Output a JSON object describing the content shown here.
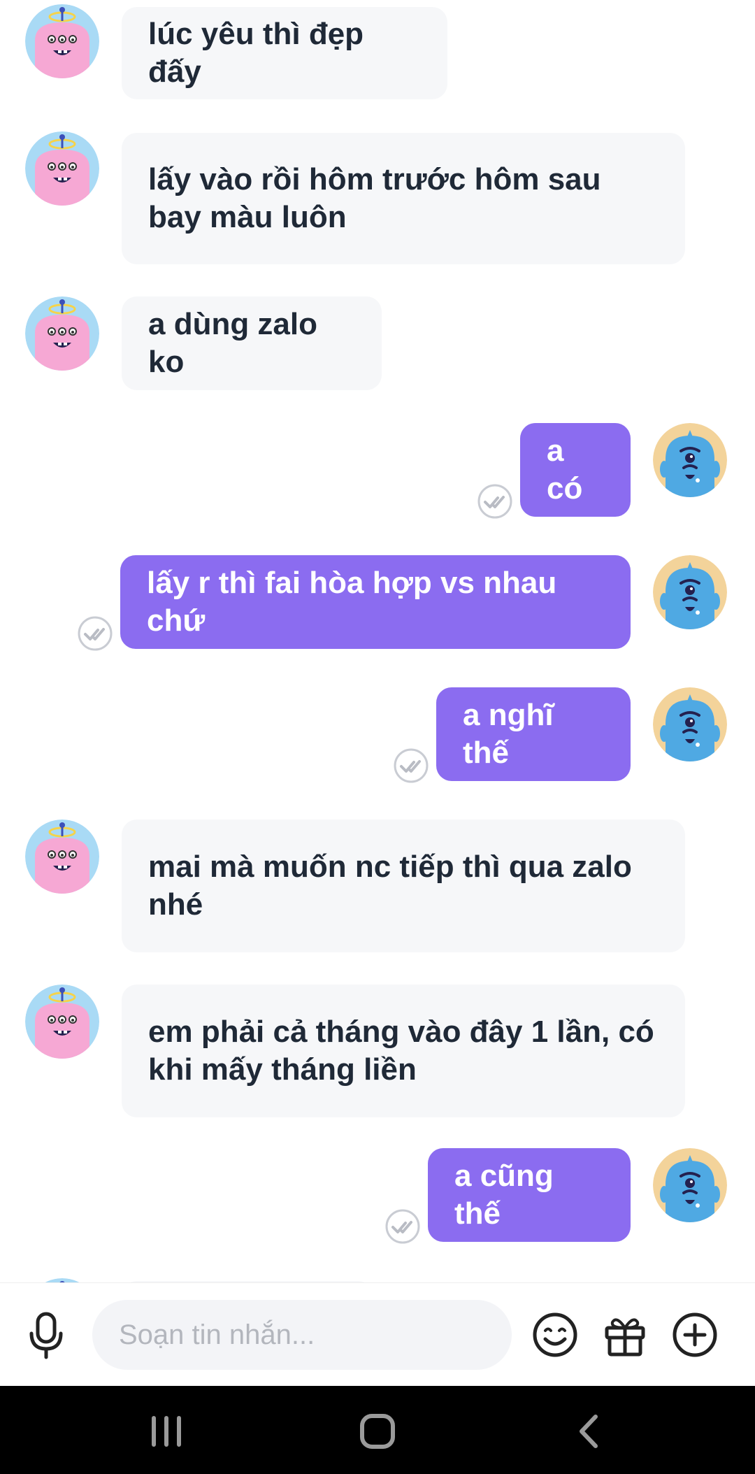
{
  "messages": [
    {
      "side": "in",
      "text": "lúc yêu thì đẹp đấy"
    },
    {
      "side": "in",
      "text": "lấy vào rồi hôm trước hôm sau bay màu luôn"
    },
    {
      "side": "in",
      "text": "a dùng zalo ko"
    },
    {
      "side": "out",
      "text": "a có"
    },
    {
      "side": "out",
      "text": "lấy r thì fai hòa hợp vs nhau chứ"
    },
    {
      "side": "out",
      "text": "a nghĩ thế"
    },
    {
      "side": "in",
      "text": "mai mà muốn nc tiếp thì qua zalo nhé"
    },
    {
      "side": "in",
      "text": "em phải cả tháng vào đây 1 lần, có khi mấy tháng liền"
    },
    {
      "side": "out",
      "text": "a cũng thế"
    }
  ],
  "composer": {
    "placeholder": "Soạn tin nhắn...",
    "icons": [
      "mic-icon",
      "emoji-icon",
      "gift-icon",
      "plus-icon"
    ]
  },
  "navbar": {
    "icons": [
      "recent-apps-icon",
      "home-icon",
      "back-icon"
    ]
  },
  "colors": {
    "outgoing_bubble": "#8b6cf0",
    "incoming_bubble": "#f6f7f9",
    "incoming_text": "#1f2937",
    "seen_check": "#b9bcc4"
  }
}
